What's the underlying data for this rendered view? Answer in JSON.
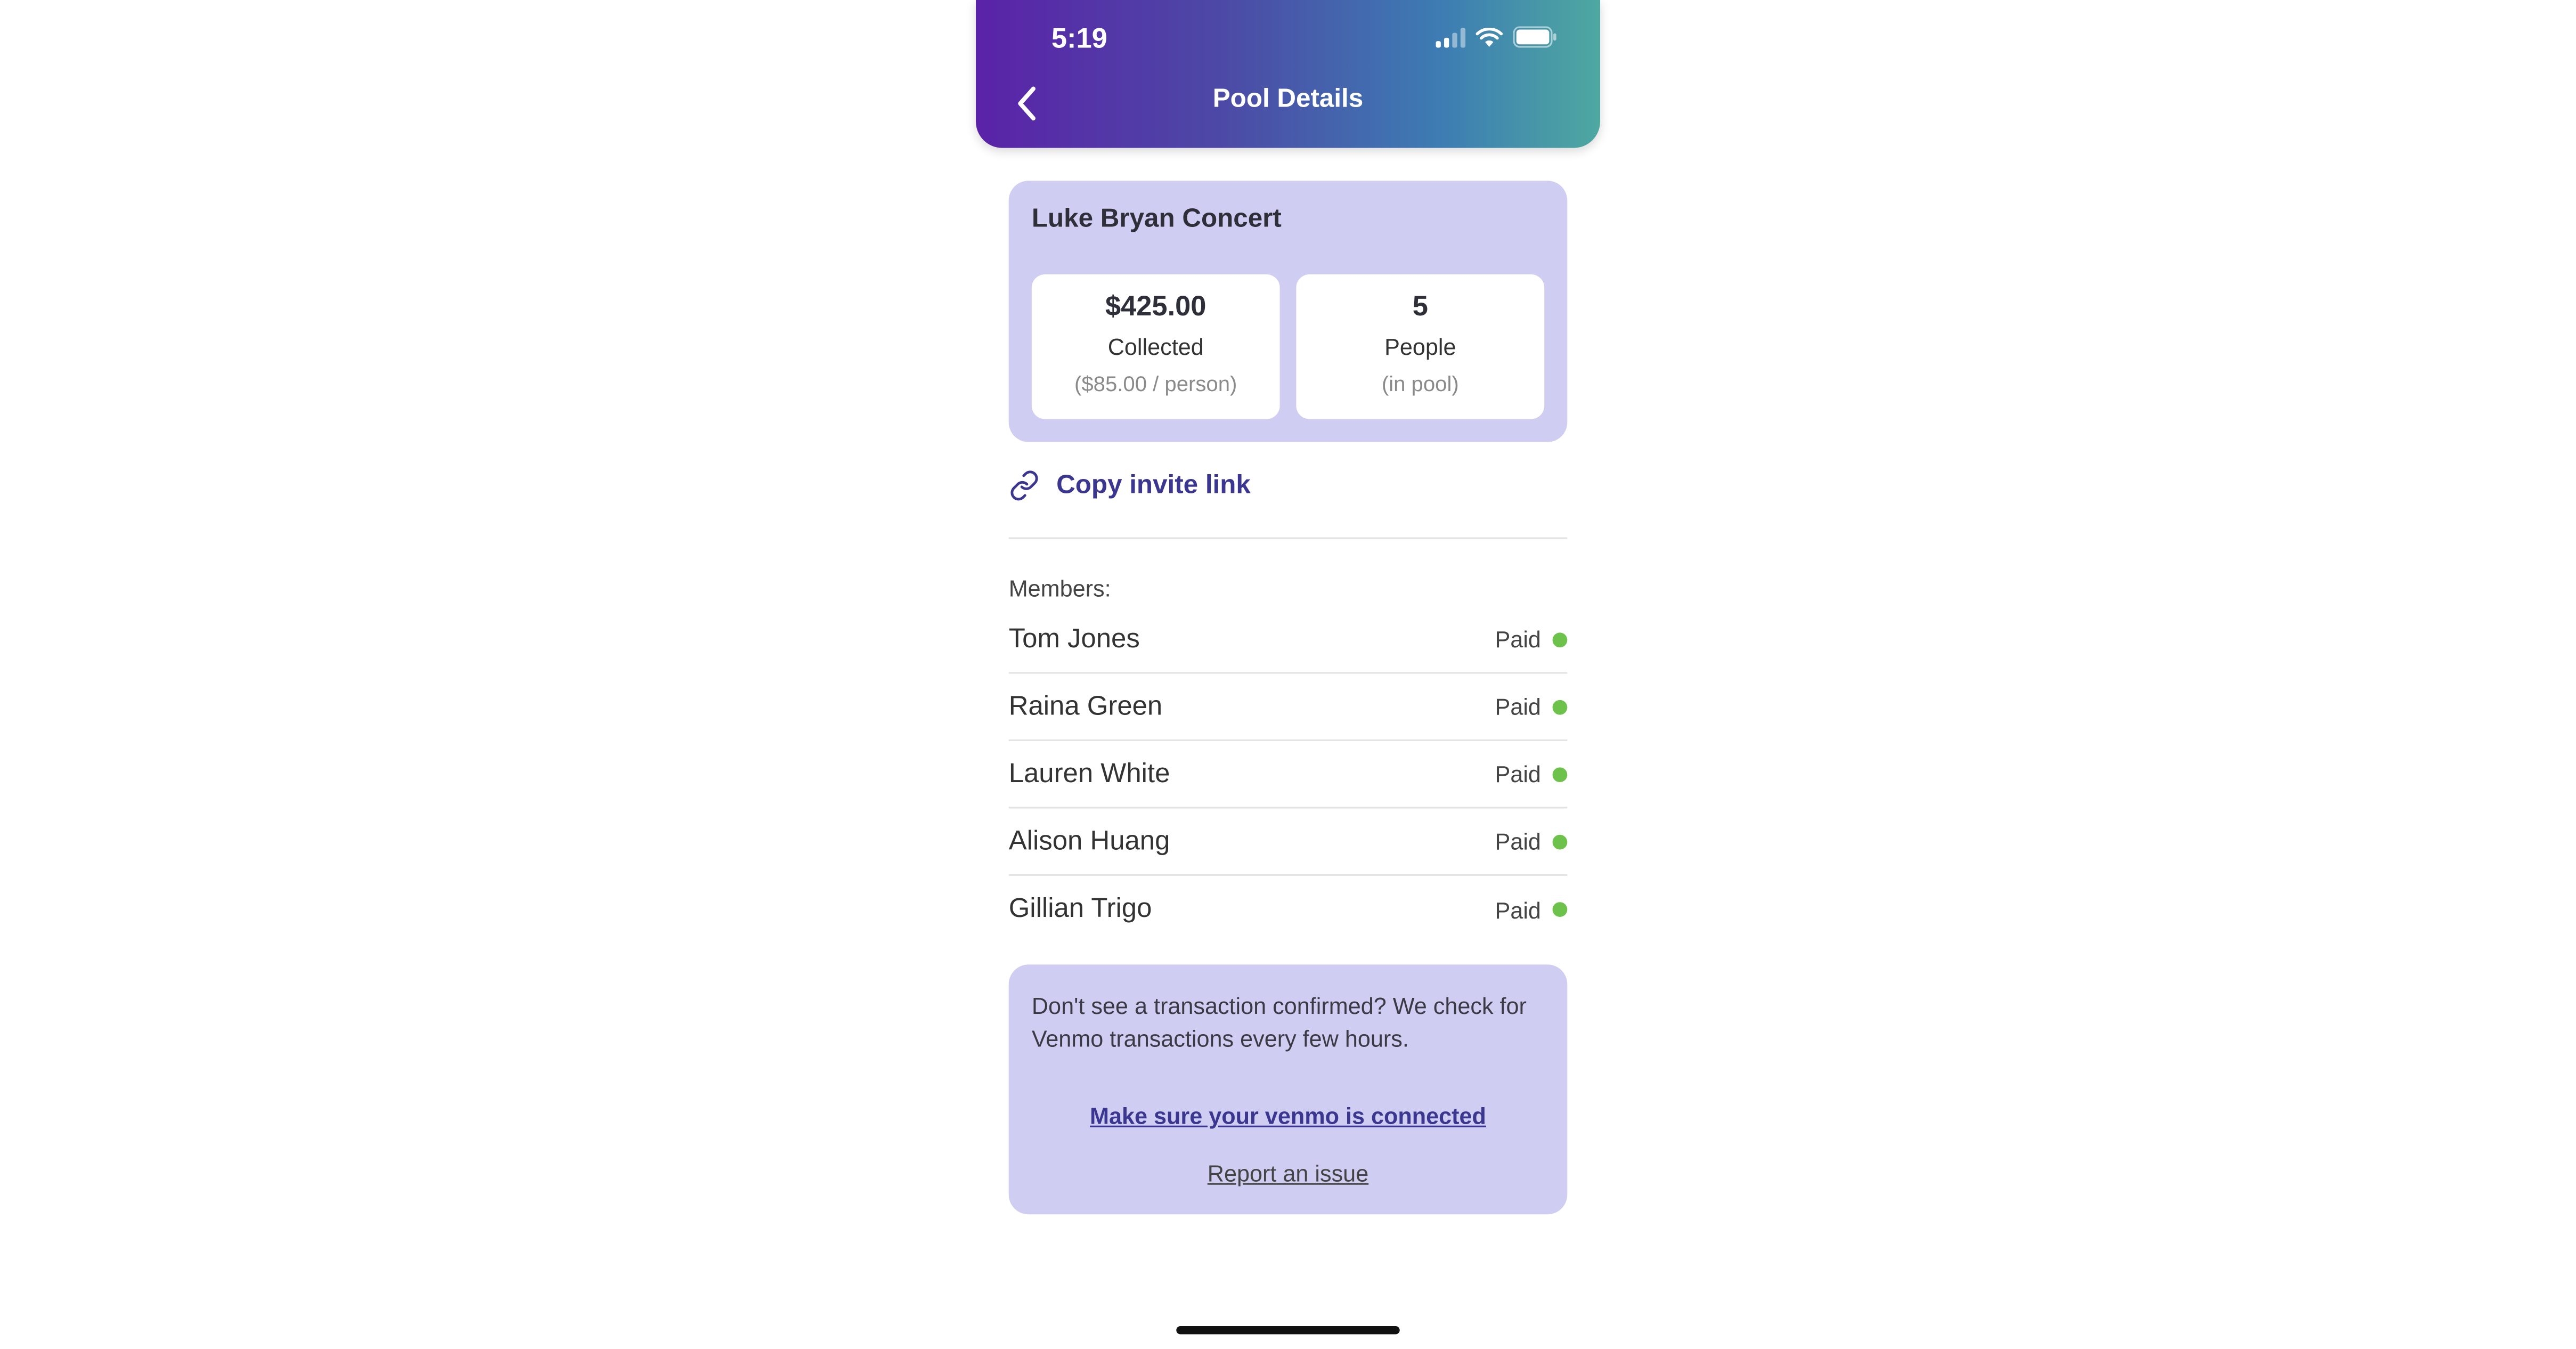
{
  "status_bar": {
    "time": "5:19"
  },
  "header": {
    "title": "Pool Details"
  },
  "pool": {
    "name": "Luke Bryan Concert",
    "collected": {
      "value": "$425.00",
      "label": "Collected",
      "sub": "($85.00 / person)"
    },
    "people": {
      "value": "5",
      "label": "People",
      "sub": "(in pool)"
    }
  },
  "invite": {
    "label": "Copy invite link"
  },
  "members": {
    "heading": "Members:",
    "items": [
      {
        "name": "Tom Jones",
        "status": "Paid"
      },
      {
        "name": "Raina Green",
        "status": "Paid"
      },
      {
        "name": "Lauren White",
        "status": "Paid"
      },
      {
        "name": "Alison Huang",
        "status": "Paid"
      },
      {
        "name": "Gillian Trigo",
        "status": "Paid"
      }
    ]
  },
  "info": {
    "text": "Don't see a transaction confirmed? We check for Venmo transactions every few hours.",
    "venmo_link": "Make sure your venmo is connected",
    "report_link": "Report an issue"
  },
  "colors": {
    "accent": "#3b3790",
    "card_bg": "#d0cdf3",
    "paid_dot": "#6cc24a",
    "header_gradient": [
      "#5a22a8",
      "#4ea8a0"
    ]
  },
  "icons": [
    "chevron-left-icon",
    "cellular-signal-icon",
    "wifi-icon",
    "battery-icon",
    "link-icon",
    "status-dot-icon"
  ]
}
